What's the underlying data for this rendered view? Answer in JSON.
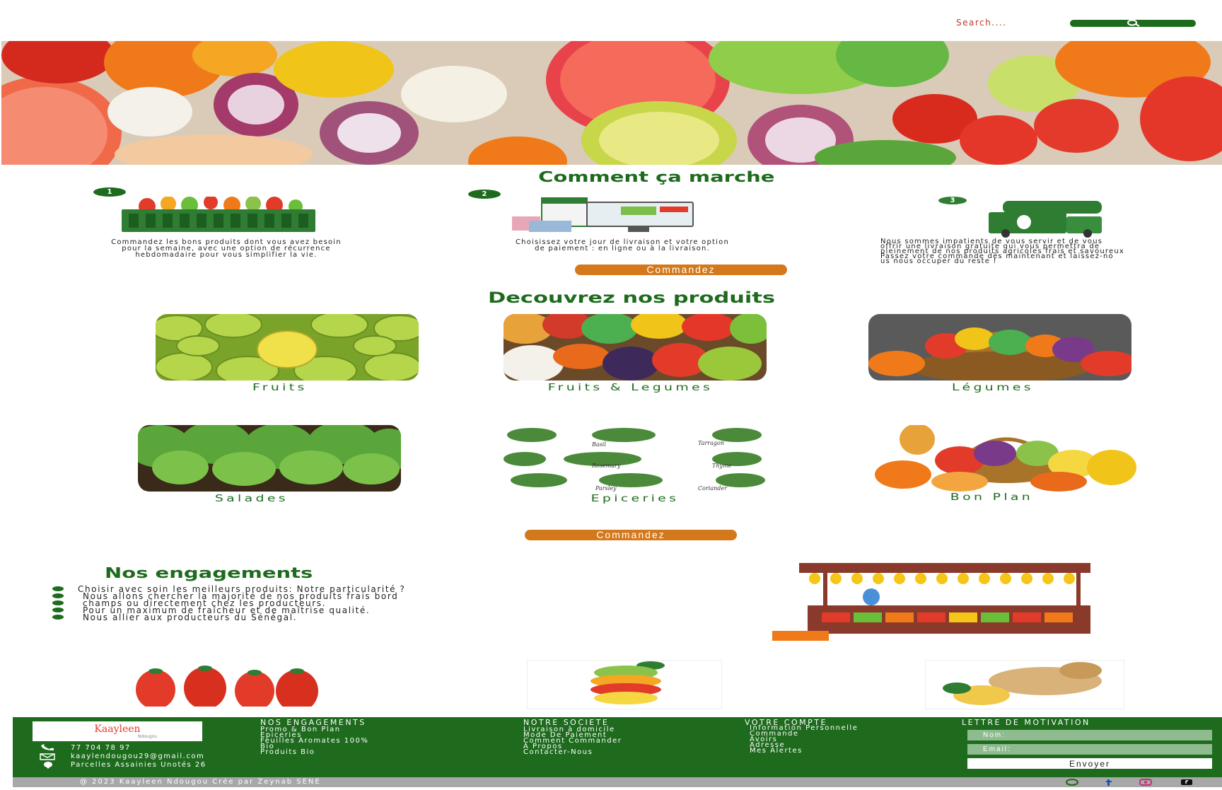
{
  "header": {
    "search_placeholder": "Search....",
    "search_button_icon": "search-icon"
  },
  "how_it_works": {
    "title": "Comment ça marche",
    "steps": [
      {
        "number": "1",
        "text_lines": [
          "Commandez les bons produits dont vous avez besoin",
          "pour la semaine, avec une option de récurrence",
          "hebdomadaire pour vous simplifier la vie."
        ]
      },
      {
        "number": "2",
        "text_lines": [
          "Choisissez votre jour de livraison et votre option",
          "de paiement : en ligne ou à la livraison."
        ]
      },
      {
        "number": "3",
        "text_lines": [
          "Nous sommes impatients de vous servir et de vous",
          "offrir une livraison gratuite qui vous permettra de",
          "pleinement de nos produits agricoles frais et savoureux",
          "Passez votre commande dès maintenant et laissez-no",
          "us nous occuper du reste !"
        ]
      }
    ],
    "order_button": "Commandez"
  },
  "products": {
    "title": "Decouvrez nos produits",
    "items": [
      {
        "label": "Fruits"
      },
      {
        "label": "Fruits & Legumes"
      },
      {
        "label": "Légumes"
      },
      {
        "label": "Salades"
      },
      {
        "label": "Epiceries"
      },
      {
        "label": "Bon Plan"
      }
    ],
    "order_button": "Commandez",
    "herb_labels": [
      "Basil",
      "Tarragon",
      "Rosemary",
      "Thyme",
      "Parsley",
      "Coriander"
    ]
  },
  "engagements": {
    "title": "Nos engagements",
    "items": [
      "Choisir avec soin les meilleurs produits: Notre particularité ?",
      "Nous allons chercher la majorité de nos produits frais bord",
      "champs ou directement chez les producteurs.",
      "Pour un maximum de fraîcheur et de maîtrise qualité.",
      "Nous allier aux producteurs du Sénégal."
    ]
  },
  "footer": {
    "logo_text": "Kaayleen",
    "logo_sub": "Ndougou",
    "phone": "77 704 78 97",
    "email": "kaaylendougou29@gmail.com",
    "address": "Parcelles Assainies Unotés 26",
    "columns": [
      {
        "title": "NOS ENGAGEMENTS",
        "links": [
          "Promo & Bon Plan",
          "Epiceries",
          "Feuilles Aromates 100%",
          "Bio",
          "Produits Bio"
        ]
      },
      {
        "title": "NOTRE SOCIETE",
        "links": [
          "Livraison à domicile",
          "Mode De Paiement",
          "Comment Commander",
          "A Propos",
          "Contacter-Nous"
        ]
      },
      {
        "title": "VOTRE COMPTE",
        "links": [
          "Information Personnelle",
          "Commande",
          "Avoirs",
          "Adresse",
          "Mes Alertes"
        ]
      }
    ],
    "newsletter": {
      "title": "LETTRE DE MOTIVATION",
      "name_placeholder": "Nom:",
      "email_placeholder": "Email:",
      "send_button": "Envoyer"
    },
    "copyright": "@ 2023 Kaayleen Ndougou Crée par Zeynab SENE",
    "social": [
      "whatsapp-icon",
      "facebook-icon",
      "instagram-icon",
      "tiktok-icon"
    ]
  },
  "colors": {
    "brand_green": "#1e6b1e",
    "accent_orange": "#d4781c",
    "search_text": "#c0392b"
  }
}
